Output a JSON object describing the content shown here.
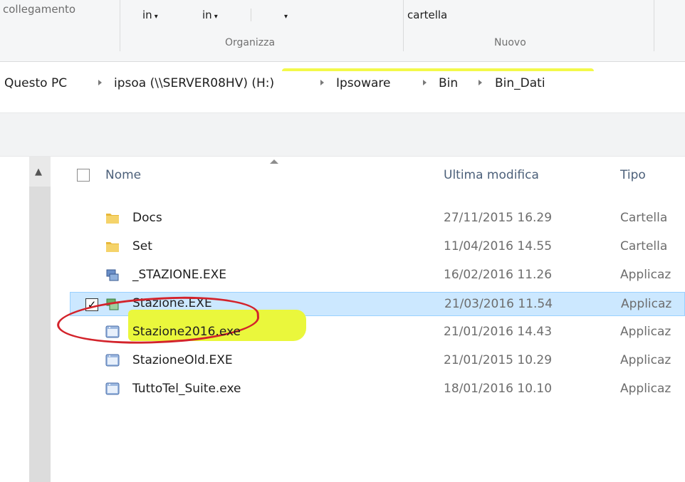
{
  "ribbon": {
    "top_left_text": "collegamento",
    "dropdown1": "in",
    "dropdown2": "in",
    "dropdown3": "",
    "nuovo_top_text": "cartella",
    "group_organizza": "Organizza",
    "group_nuovo": "Nuovo",
    "caret": "▾"
  },
  "address": {
    "crumbs": [
      "Questo PC",
      "ipsoa (\\\\SERVER08HV) (H:)",
      "Ipsoware",
      "Bin",
      "Bin_Dati"
    ]
  },
  "columns": {
    "name": "Nome",
    "modified": "Ultima modifica",
    "type": "Tipo"
  },
  "files": [
    {
      "name": "Docs",
      "modified": "27/11/2015 16.29",
      "type": "Cartella",
      "icon": "folder-icon"
    },
    {
      "name": "Set",
      "modified": "11/04/2016 14.55",
      "type": "Cartella",
      "icon": "folder-icon"
    },
    {
      "name": "_STAZIONE.EXE",
      "modified": "16/02/2016 11.26",
      "type": "Applicaz",
      "icon": "app-monitor-icon"
    },
    {
      "name": "Stazione.EXE",
      "modified": "21/03/2016 11.54",
      "type": "Applicaz",
      "icon": "app-monitor-icon",
      "selected": true
    },
    {
      "name": "Stazione2016.exe",
      "modified": "21/01/2016 14.43",
      "type": "Applicaz",
      "icon": "app-window-icon"
    },
    {
      "name": "StazioneOld.EXE",
      "modified": "21/01/2015 10.29",
      "type": "Applicaz",
      "icon": "app-window-icon"
    },
    {
      "name": "TuttoTel_Suite.exe",
      "modified": "18/01/2016 10.10",
      "type": "Applicaz",
      "icon": "app-window-icon"
    }
  ],
  "selection_check": "✓",
  "colors": {
    "highlight_yellow": "#f3f94a",
    "selection_blue": "#cce8ff",
    "annotation_red": "#d3232b",
    "folder_yellow": "#e8b83a"
  }
}
